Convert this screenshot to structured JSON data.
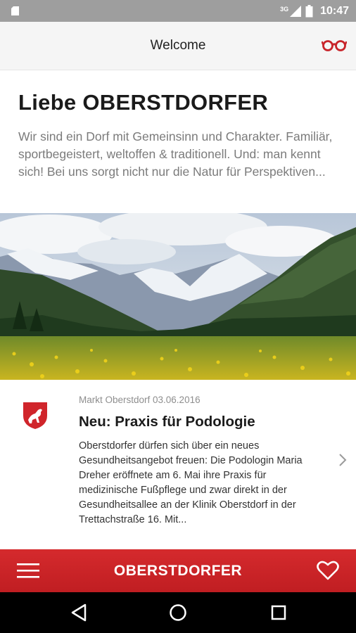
{
  "status_bar": {
    "time": "10:47",
    "network": "3G",
    "icons": [
      "notification-icon",
      "signal-icon",
      "battery-icon"
    ]
  },
  "app_bar": {
    "title": "Welcome",
    "action_icon": "glasses-icon"
  },
  "intro": {
    "heading": "Liebe OBERSTDORFER",
    "text": "Wir sind ein Dorf mit Gemeinsinn und Charakter. Familiär, sportbegeistert, weltoffen & traditionell. Und: man kennt sich! Bei uns sorgt nicht nur die Natur für Perspektiven..."
  },
  "hero_image": {
    "subject": "mountain-valley-photo"
  },
  "news_item": {
    "source_date": "Markt Oberstdorf 03.06.2016",
    "title": "Neu: Praxis für Podologie",
    "body": "Oberstdorfer dürfen sich über ein neues Gesundheitsangebot freuen: Die Podologin Maria Dreher eröffnete am 6. Mai ihre Praxis für medizinische Fußpflege und zwar direkt in der Gesundheitsallee an der Klinik Oberstdorf in der Trettachstraße 16. Mit...",
    "icon": "crest-icon"
  },
  "bottom_bar": {
    "brand": "OBERSTDORFER",
    "menu_icon": "menu-icon",
    "favorite_icon": "heart-icon"
  },
  "nav_bar": {
    "buttons": [
      "back-icon",
      "home-icon",
      "recents-icon"
    ]
  },
  "colors": {
    "brand_red": "#c8242a",
    "status_bar": "#9e9e9e",
    "app_bar": "#f5f5f5"
  }
}
